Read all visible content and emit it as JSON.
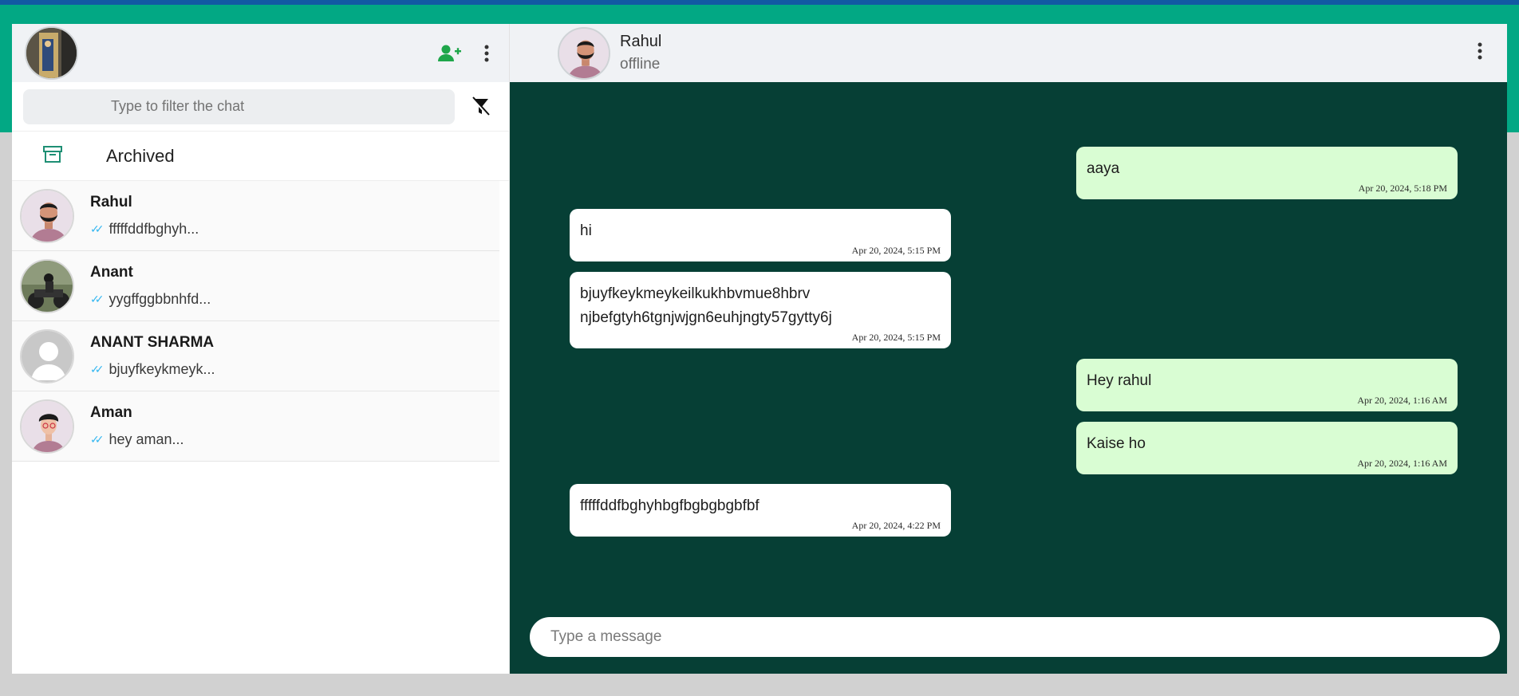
{
  "colors": {
    "top_line": "#1259a3",
    "top_band": "#02a884",
    "chat_bg": "#063f35",
    "outgoing_bubble": "#d9fdd3",
    "incoming_bubble": "#ffffff",
    "accent_green": "#1daa61"
  },
  "sidebar": {
    "search_placeholder": "Type to filter the chat",
    "archived_label": "Archived",
    "chats": [
      {
        "name": "Rahul",
        "last_message": "fffffddfbghyh..."
      },
      {
        "name": "Anant",
        "last_message": "yygffggbbnhfd..."
      },
      {
        "name": "ANANT SHARMA",
        "last_message": "bjuyfkeykmeyk..."
      },
      {
        "name": "Aman",
        "last_message": "hey aman..."
      }
    ]
  },
  "conversation": {
    "peer_name": "Rahul",
    "peer_status": "offline",
    "messages": [
      {
        "direction": "out",
        "text": "aaya",
        "time": "Apr 20, 2024, 5:18 PM"
      },
      {
        "direction": "in",
        "text": "hi",
        "time": "Apr 20, 2024, 5:15 PM"
      },
      {
        "direction": "in",
        "text": "bjuyfkeykmeykeilkukhbvmue8hbrv\nnjbefgtyh6tgnjwjgn6euhjngty57gytty6j",
        "time": "Apr 20, 2024, 5:15 PM"
      },
      {
        "direction": "out",
        "text": "Hey rahul",
        "time": "Apr 20, 2024, 1:16 AM"
      },
      {
        "direction": "out",
        "text": "Kaise ho",
        "time": "Apr 20, 2024, 1:16 AM"
      },
      {
        "direction": "in",
        "text": "fffffddfbghyhbgfbgbgbgbfbf",
        "time": "Apr 20, 2024, 4:22 PM"
      }
    ],
    "composer_placeholder": "Type a message"
  },
  "icons": {
    "new_chat": "person-add-icon",
    "menu": "kebab-menu-icon",
    "filter": "filter-off-icon",
    "archive": "archive-box-icon",
    "read_receipt": "double-check-icon",
    "mic": "microphone-icon"
  }
}
